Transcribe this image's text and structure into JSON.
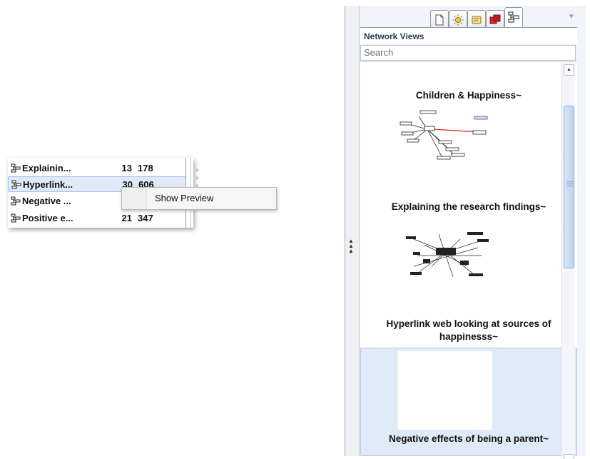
{
  "list": {
    "rows": [
      {
        "name": "Explainin...",
        "count1": "13",
        "count2": "178",
        "selected": false
      },
      {
        "name": "Hyperlink...",
        "count1": "30",
        "count2": "606",
        "selected": true
      },
      {
        "name": "Negative ...",
        "count1": "",
        "count2": "",
        "selected": false
      },
      {
        "name": "Positive e...",
        "count1": "21",
        "count2": "347",
        "selected": false
      }
    ]
  },
  "context_menu": {
    "items": [
      "Show Preview"
    ]
  },
  "network_views": {
    "title": "Network Views",
    "search_placeholder": "Search",
    "tabs": [
      {
        "icon": "document-icon",
        "active": false
      },
      {
        "icon": "sun-memo-icon",
        "active": false
      },
      {
        "icon": "note-icon",
        "active": false
      },
      {
        "icon": "family-icon",
        "active": false
      },
      {
        "icon": "network-icon",
        "active": true
      }
    ],
    "views": [
      {
        "label": "Children & Happiness~",
        "selected": false
      },
      {
        "label": "Explaining the research findings~",
        "selected": false
      },
      {
        "label": "Hyperlink web looking at sources of happinesss~",
        "selected": false
      },
      {
        "label": "Negative effects of being a parent~",
        "selected": true
      }
    ]
  },
  "colors": {
    "selection_bg": "#dfe9f8",
    "selection_border": "#a9c1e8",
    "header_text": "#2a3a54",
    "accent_red": "#e02020",
    "accent_green": "#27a837"
  }
}
